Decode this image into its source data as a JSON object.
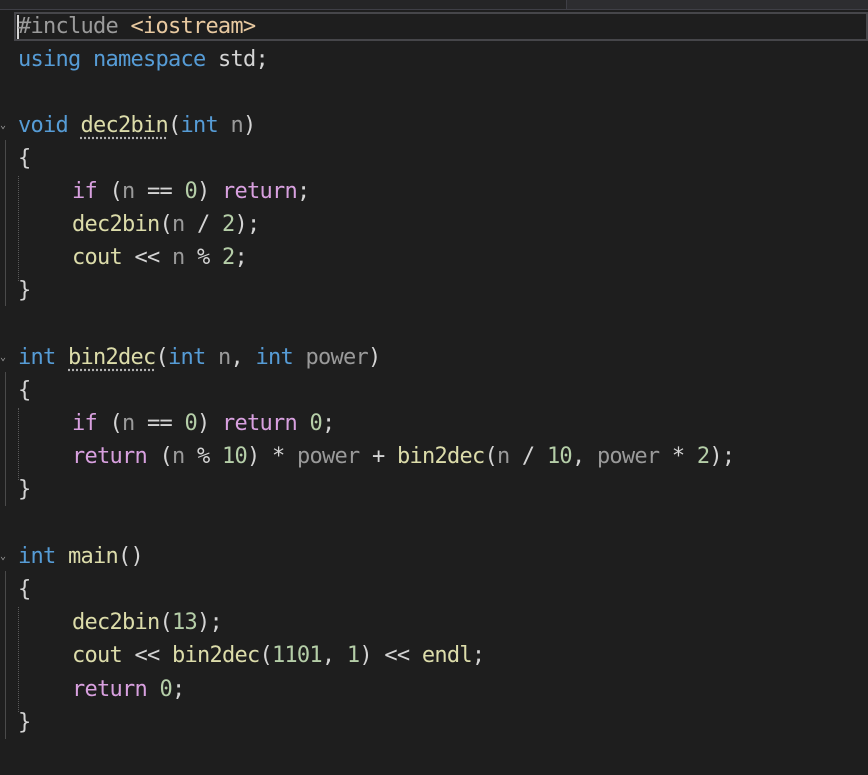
{
  "tokens": {
    "hash_include": "#include",
    "iostream": "<iostream>",
    "using": "using",
    "namespace": "namespace",
    "std": "std;",
    "void": "void",
    "int": "int",
    "dec2bin": "dec2bin",
    "bin2dec": "bin2dec",
    "main": "main",
    "n": "n",
    "power": "power",
    "if": "if",
    "return": "return",
    "cout": "cout",
    "endl": "endl",
    "open_paren": "(",
    "close_paren": ")",
    "empty_parens": "()",
    "open_brace": "{",
    "close_brace": "}",
    "semi": ";",
    "paren_semi": ");",
    "comma": ", ",
    "eq_zero": " == ",
    "shl": " << ",
    "mod": " % ",
    "div": " / ",
    "mul": " * ",
    "plus": " + ",
    "space": " ",
    "zero": "0",
    "one": "1",
    "two": "2",
    "ten": "10",
    "thirteen": "13",
    "n1101": "1101"
  }
}
